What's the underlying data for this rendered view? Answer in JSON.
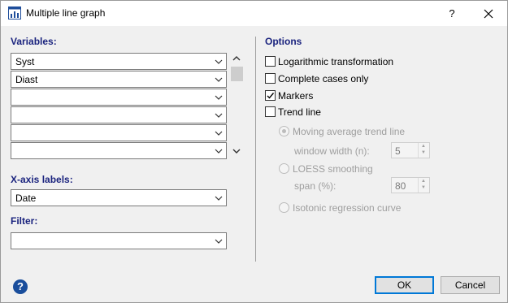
{
  "window": {
    "title": "Multiple line graph",
    "help_label": "?",
    "close_label": "✕"
  },
  "variables": {
    "label": "Variables:",
    "items": [
      "Syst",
      "Diast",
      "",
      "",
      "",
      ""
    ]
  },
  "xaxis": {
    "label": "X-axis labels:",
    "value": "Date"
  },
  "filter": {
    "label": "Filter:",
    "value": ""
  },
  "options": {
    "label": "Options",
    "checkboxes": [
      {
        "label": "Logarithmic transformation",
        "checked": false
      },
      {
        "label": "Complete cases only",
        "checked": false
      },
      {
        "label": "Markers",
        "checked": true
      },
      {
        "label": "Trend line",
        "checked": false
      }
    ],
    "trend": {
      "moving_average_label": "Moving average trend line",
      "window_width_label": "window width (n):",
      "window_width_value": "5",
      "loess_label": "LOESS smoothing",
      "span_label": "span (%):",
      "span_value": "80",
      "isotonic_label": "Isotonic regression curve"
    }
  },
  "buttons": {
    "ok": "OK",
    "cancel": "Cancel"
  },
  "colors": {
    "section_label": "#1a237e",
    "ok_border": "#0078d7"
  }
}
